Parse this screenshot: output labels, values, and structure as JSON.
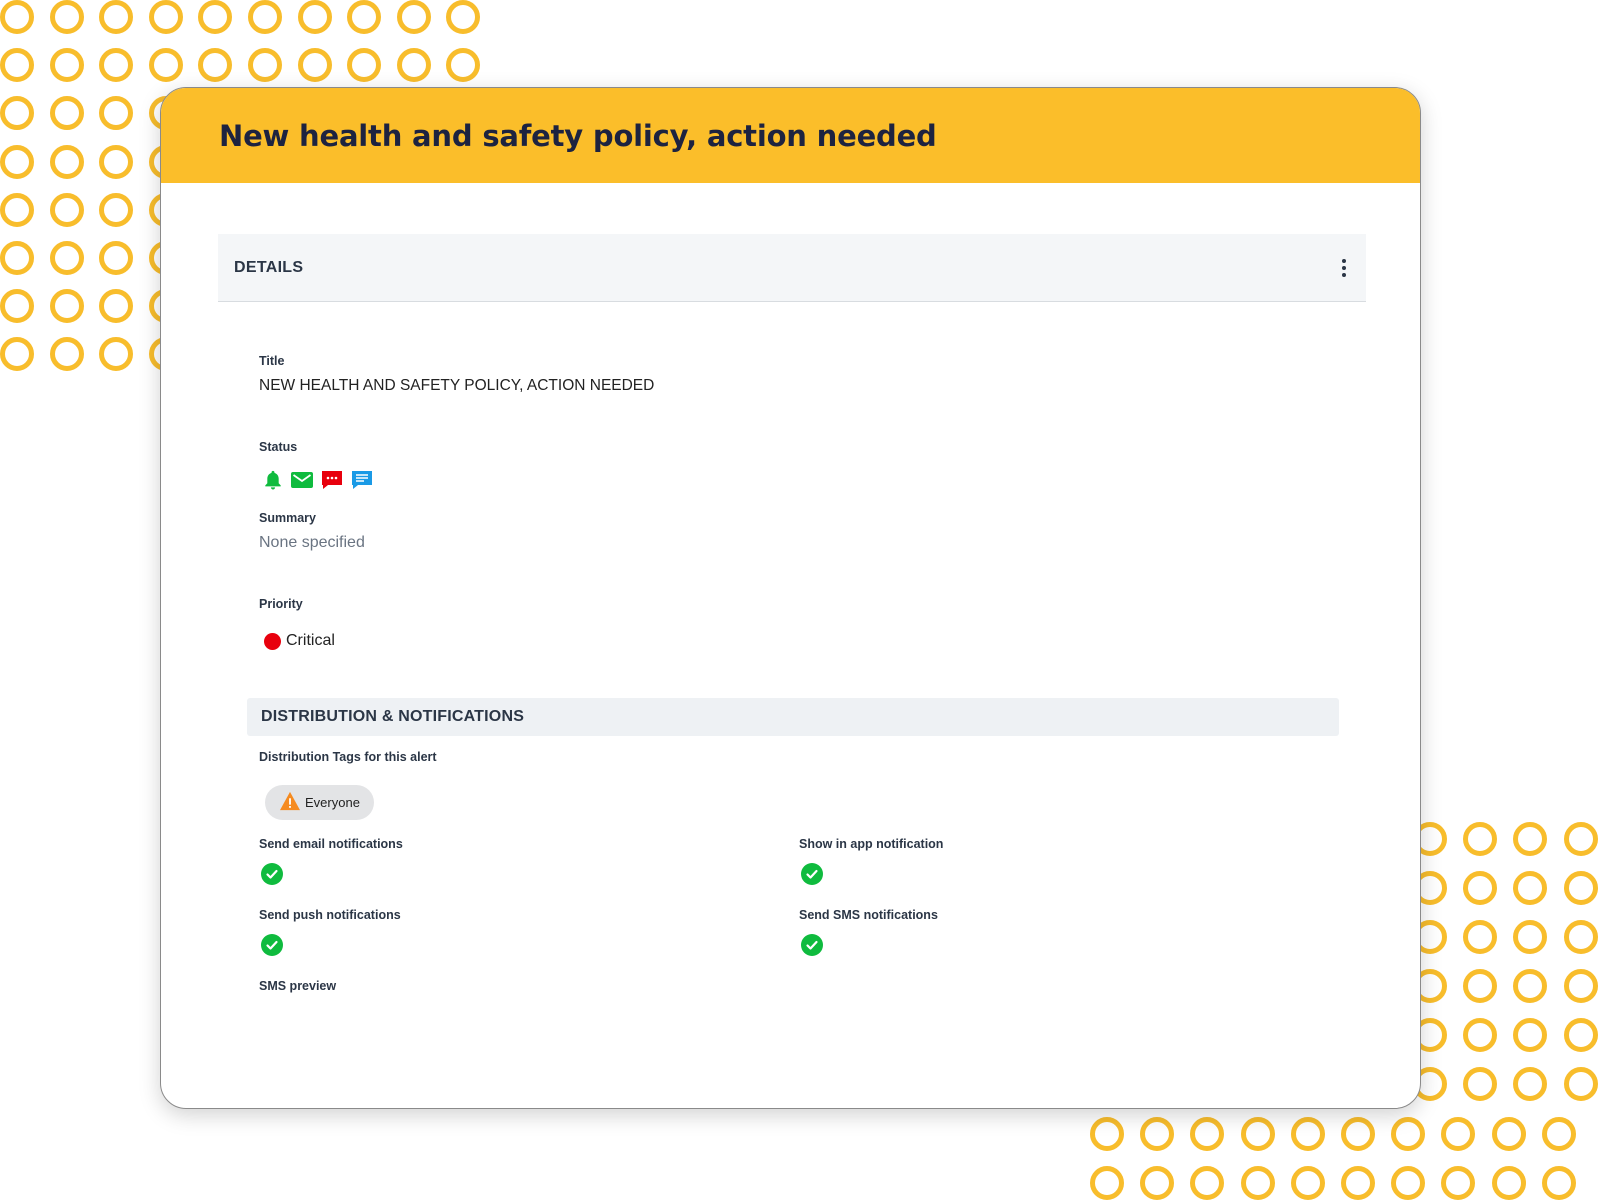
{
  "theme": {
    "accent": "#fbbe2a",
    "ring_color": "#f8bd2c",
    "success": "#0fbb3e",
    "critical": "#e8000d",
    "sms_icon_color": "#e8000d",
    "chat_icon_color": "#1a9ae6"
  },
  "banner": {
    "title": "New health and safety policy, action needed"
  },
  "details": {
    "header": "DETAILS",
    "menu_icon": "more-vertical-icon",
    "title_label": "Title",
    "title_value": "NEW HEALTH AND SAFETY POLICY, ACTION NEEDED",
    "status_label": "Status",
    "status_icons": [
      "bell-icon",
      "mail-icon",
      "sms-icon",
      "chat-icon"
    ],
    "summary_label": "Summary",
    "summary_value": "None specified",
    "priority_label": "Priority",
    "priority_value": "Critical"
  },
  "distribution": {
    "header": "DISTRIBUTION & NOTIFICATIONS",
    "tags_label": "Distribution Tags for this alert",
    "tag": {
      "icon": "warning-icon",
      "label": "Everyone"
    },
    "email_label": "Send email notifications",
    "email_enabled": true,
    "in_app_label": "Show in app notification",
    "in_app_enabled": true,
    "push_label": "Send push notifications",
    "push_enabled": true,
    "sms_label": "Send SMS notifications",
    "sms_enabled": true,
    "sms_preview_label": "SMS preview"
  }
}
